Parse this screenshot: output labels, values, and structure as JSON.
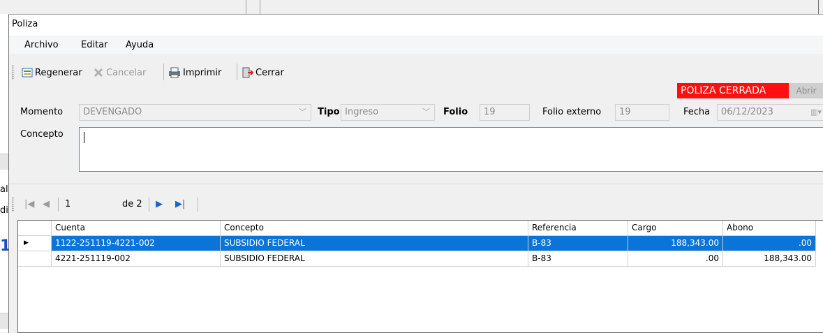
{
  "window": {
    "title": "Poliza"
  },
  "menu": {
    "items": [
      "Archivo",
      "Editar",
      "Ayuda"
    ]
  },
  "toolbar": {
    "regenerar": "Regenerar",
    "cancelar": "Cancelar",
    "imprimir": "Imprimir",
    "cerrar": "Cerrar"
  },
  "status": {
    "badge": "POLIZA CERRADA",
    "abrir": "Abrir",
    "badge_color": "#ff1010"
  },
  "form": {
    "momento_label": "Momento",
    "momento_value": "DEVENGADO",
    "tipo_label": "Tipo",
    "tipo_value": "Ingreso",
    "folio_label": "Folio",
    "folio_value": "19",
    "folio_ext_label": "Folio externo",
    "folio_ext_value": "19",
    "fecha_label": "Fecha",
    "fecha_value": "06/12/2023",
    "concepto_label": "Concepto",
    "concepto_value": ""
  },
  "navigator": {
    "position": "1",
    "of_total": "de 2"
  },
  "grid": {
    "columns": [
      "Cuenta",
      "Concepto",
      "Referencia",
      "Cargo",
      "Abono"
    ],
    "rows": [
      {
        "cuenta": "1122-251119-4221-002",
        "concepto": "SUBSIDIO FEDERAL",
        "referencia": "B-83",
        "cargo": "188,343.00",
        "abono": ".00",
        "selected": true
      },
      {
        "cuenta": "4221-251119-002",
        "concepto": "SUBSIDIO FEDERAL",
        "referencia": "B-83",
        "cargo": ".00",
        "abono": "188,343.00",
        "selected": false
      }
    ],
    "selection_color": "#0a74d8"
  },
  "background": {
    "frag1": "al",
    "frag2": "di",
    "frag3": "1"
  }
}
